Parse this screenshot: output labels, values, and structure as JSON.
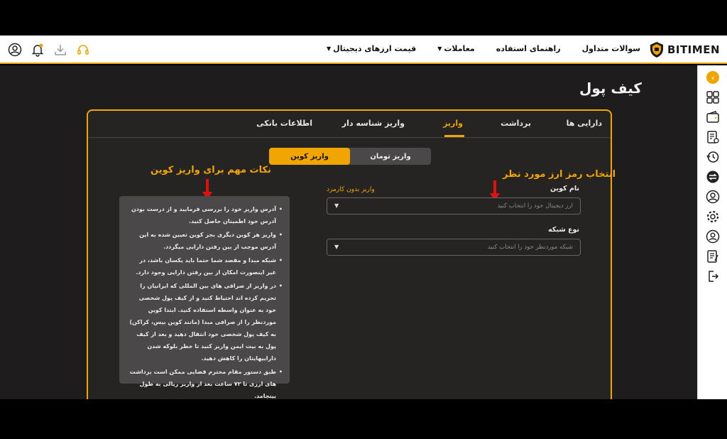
{
  "header": {
    "logo_text": "BITIMEN",
    "nav": [
      {
        "label": "قیمت ارزهای دیجیتال",
        "has_caret": true
      },
      {
        "label": "معاملات",
        "has_caret": true
      },
      {
        "label": "راهنمای استفاده",
        "has_caret": false
      },
      {
        "label": "سوالات متداول",
        "has_caret": false
      }
    ],
    "icons": [
      "user-icon",
      "bell-icon",
      "download-icon",
      "headset-icon"
    ],
    "accent_color": "#f0a500"
  },
  "page": {
    "title": "کیف پول"
  },
  "tabs": [
    {
      "label": "دارایی ها",
      "active": false
    },
    {
      "label": "برداشت",
      "active": false
    },
    {
      "label": "واریز",
      "active": true
    },
    {
      "label": "واریز شناسه دار",
      "active": false
    },
    {
      "label": "اطلاعات بانکی",
      "active": false
    }
  ],
  "deposit_type": {
    "toman": "واریز تومان",
    "coin": "واریز کوین",
    "selected": "coin"
  },
  "annotations": {
    "select_coin": "انتخاب رمز ارز مورد نظر",
    "notes_title": "نکات مهم برای واریز کوین"
  },
  "form": {
    "coin_label": "نام کوین",
    "fee_free_link": "واریز بدون کارمزد",
    "coin_placeholder": "ارز دیجیتال خود را انتخاب کنید",
    "network_label": "نوع شبکه",
    "network_placeholder": "شبکه موردنظر خود را انتخاب کنید"
  },
  "notes": [
    "آدرس واریز خود را بررسی فرمایید و از درست بودن آدرس خود اطمینان حاصل کنید.",
    "واریز هر کوین دیگری بجز کوین تعیین شده به این آدرس موجب از بین رفتن دارایی میگردد.",
    "شبکه مبدا و مقصد شما حتما باید یکسان باشد، در غیر اینصورت امکان از بین رفتن دارایی وجود دارد.",
    "در واریز از صرافی های بین المللی که ایرانیان را تحریم کرده اند احتیاط کنید و از کیف پول شخصی خود به عنوان واسطه استفاده کنید. ابتدا کوین موردنظر را از صرافی مبدا (مانند کوین بیس، کراکن) به کیف پول شخصی خود انتقال دهید و بعد از کیف پول به بیت ایمن واریز کنید تا خطر بلوکه شدن داراییهایتان را کاهش دهید.",
    "طبق دستور مقام محترم قضایی ممکن است برداشت های ارزی تا ۷۲ ساعت بعد از واریز ریالی به طول بینجامد."
  ],
  "sidebar": {
    "icons": [
      "collapse-icon",
      "dashboard-icon",
      "wallet-icon",
      "orders-icon",
      "history-icon",
      "exchange-icon",
      "profile-icon",
      "settings-icon",
      "verify-icon",
      "report-icon",
      "logout-icon"
    ]
  }
}
